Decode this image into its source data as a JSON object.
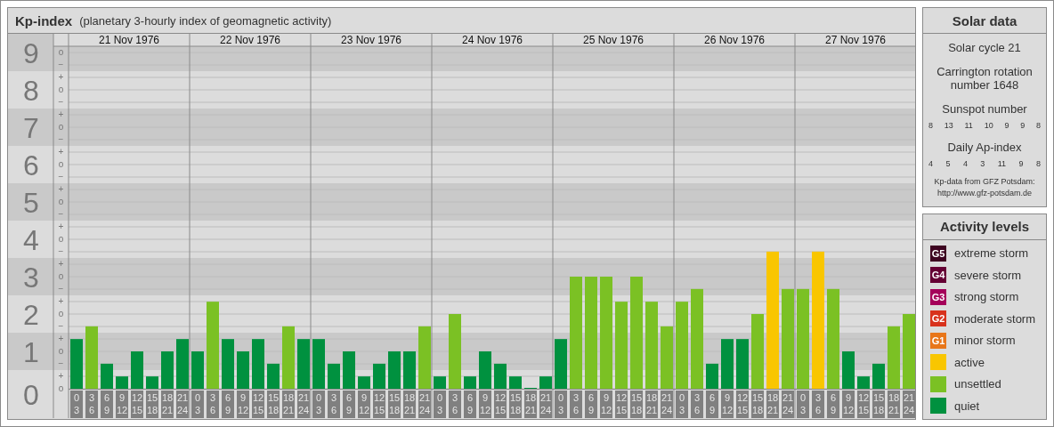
{
  "title": "Kp-index",
  "subtitle": "(planetary 3-hourly index of geomagnetic activity)",
  "days": [
    "21 Nov 1976",
    "22 Nov 1976",
    "23 Nov 1976",
    "24 Nov 1976",
    "25 Nov 1976",
    "26 Nov 1976",
    "27 Nov 1976"
  ],
  "scale_marks": [
    "o",
    "−",
    "+",
    "o",
    "−",
    "+",
    "o",
    "−",
    "+",
    "o",
    "−",
    "+",
    "o",
    "−",
    "+",
    "o",
    "−",
    "+",
    "o",
    "−",
    "+",
    "o",
    "−",
    "+",
    "o",
    "−",
    "+",
    "o"
  ],
  "chart_data": {
    "type": "bar",
    "grid": true,
    "ylim": [
      0,
      9
    ],
    "yticks": [
      0,
      1,
      2,
      3,
      4,
      5,
      6,
      7,
      8,
      9
    ],
    "categories": [
      "0 3",
      "3 6",
      "6 9",
      "9 12",
      "12 15",
      "15 18",
      "18 21",
      "21 24",
      "0 3",
      "3 6",
      "6 9",
      "9 12",
      "12 15",
      "15 18",
      "18 21",
      "21 24",
      "0 3",
      "3 6",
      "6 9",
      "9 12",
      "12 15",
      "15 18",
      "18 21",
      "21 24",
      "0 3",
      "3 6",
      "6 9",
      "9 12",
      "12 15",
      "15 18",
      "18 21",
      "21 24",
      "0 3",
      "3 6",
      "6 9",
      "9 12",
      "12 15",
      "15 18",
      "18 21",
      "21 24",
      "0 3",
      "3 6",
      "6 9",
      "9 12",
      "12 15",
      "15 18",
      "18 21",
      "21 24",
      "0 3",
      "3 6",
      "6 9",
      "9 12",
      "12 15",
      "15 18",
      "18 21",
      "21 24"
    ],
    "series": [
      {
        "name": "quiet",
        "color": "#00913f",
        "values": [
          1.33,
          null,
          0.67,
          0.33,
          1,
          0.33,
          1,
          1.33,
          1,
          null,
          1.33,
          1,
          1.33,
          0.67,
          null,
          1.33,
          1.33,
          0.67,
          1,
          0.33,
          0.67,
          1,
          1,
          null,
          0.33,
          null,
          0.33,
          1,
          0.67,
          0.33,
          0,
          0.33,
          1.33,
          null,
          null,
          null,
          null,
          null,
          null,
          null,
          null,
          null,
          0.67,
          1.33,
          1.33,
          null,
          null,
          null,
          null,
          null,
          null,
          1,
          0.33,
          0.67,
          null,
          null
        ]
      },
      {
        "name": "unsettled",
        "color": "#7bc124",
        "values": [
          null,
          1.67,
          null,
          null,
          null,
          null,
          null,
          null,
          null,
          2.33,
          null,
          null,
          null,
          null,
          1.67,
          null,
          null,
          null,
          null,
          null,
          null,
          null,
          null,
          1.67,
          null,
          2,
          null,
          null,
          null,
          null,
          null,
          null,
          null,
          3,
          3,
          3,
          2.33,
          3,
          2.33,
          1.67,
          2.33,
          2.67,
          null,
          null,
          null,
          2,
          null,
          2.67,
          2.67,
          null,
          2.67,
          null,
          null,
          null,
          1.67,
          2
        ]
      },
      {
        "name": "active",
        "color": "#f9c600",
        "values": [
          null,
          null,
          null,
          null,
          null,
          null,
          null,
          null,
          null,
          null,
          null,
          null,
          null,
          null,
          null,
          null,
          null,
          null,
          null,
          null,
          null,
          null,
          null,
          null,
          null,
          null,
          null,
          null,
          null,
          null,
          null,
          null,
          null,
          null,
          null,
          null,
          null,
          null,
          null,
          null,
          null,
          null,
          null,
          null,
          null,
          null,
          3.67,
          null,
          null,
          3.67,
          null,
          null,
          null,
          null,
          null,
          null
        ]
      }
    ]
  },
  "solar": {
    "title": "Solar data",
    "cycle": "Solar cycle 21",
    "rotation": "Carrington rotation number 1648",
    "sunspot_label": "Sunspot number",
    "sunspot": [
      "8",
      "13",
      "11",
      "10",
      "9",
      "9",
      "8"
    ],
    "ap_label": "Daily Ap-index",
    "ap": [
      "4",
      "5",
      "4",
      "3",
      "11",
      "9",
      "8"
    ],
    "source_note": "Kp-data from GFZ Potsdam:",
    "source_url": "http://www.gfz-potsdam.de"
  },
  "legend": {
    "title": "Activity levels",
    "items": [
      {
        "badge": "G5",
        "label": "extreme storm",
        "color": "#3d0320"
      },
      {
        "badge": "G4",
        "label": "severe storm",
        "color": "#650034"
      },
      {
        "badge": "G3",
        "label": "strong storm",
        "color": "#a5005a"
      },
      {
        "badge": "G2",
        "label": "moderate storm",
        "color": "#d8321c"
      },
      {
        "badge": "G1",
        "label": "minor storm",
        "color": "#e8761a"
      }
    ]
  }
}
